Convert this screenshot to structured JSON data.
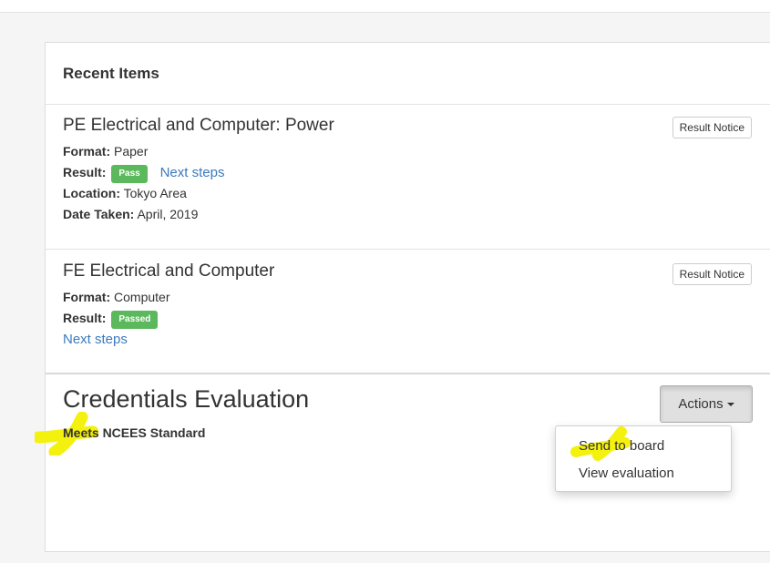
{
  "colors": {
    "badge_green": "#5cb85c",
    "link_blue": "#3a7abf",
    "highlight_yellow": "#f4f10e"
  },
  "icons": {
    "actions_caret": "caret-down-icon"
  },
  "recent_items": {
    "heading": "Recent Items",
    "items": [
      {
        "title": "PE Electrical and Computer: Power",
        "result_notice_label": "Result Notice",
        "format_label": "Format:",
        "format_value": "Paper",
        "result_label": "Result:",
        "result_value": "Pass",
        "next_steps": "Next steps",
        "location_label": "Location:",
        "location_value": "Tokyo Area",
        "date_label": "Date Taken:",
        "date_value": "April, 2019"
      },
      {
        "title": "FE Electrical and Computer",
        "result_notice_label": "Result Notice",
        "format_label": "Format:",
        "format_value": "Computer",
        "result_label": "Result:",
        "result_value": "Passed",
        "next_steps": "Next steps"
      }
    ]
  },
  "credentials": {
    "title": "Credentials Evaluation",
    "status": "Meets NCEES Standard",
    "actions_label": "Actions",
    "menu": [
      "Send to board",
      "View evaluation"
    ]
  }
}
